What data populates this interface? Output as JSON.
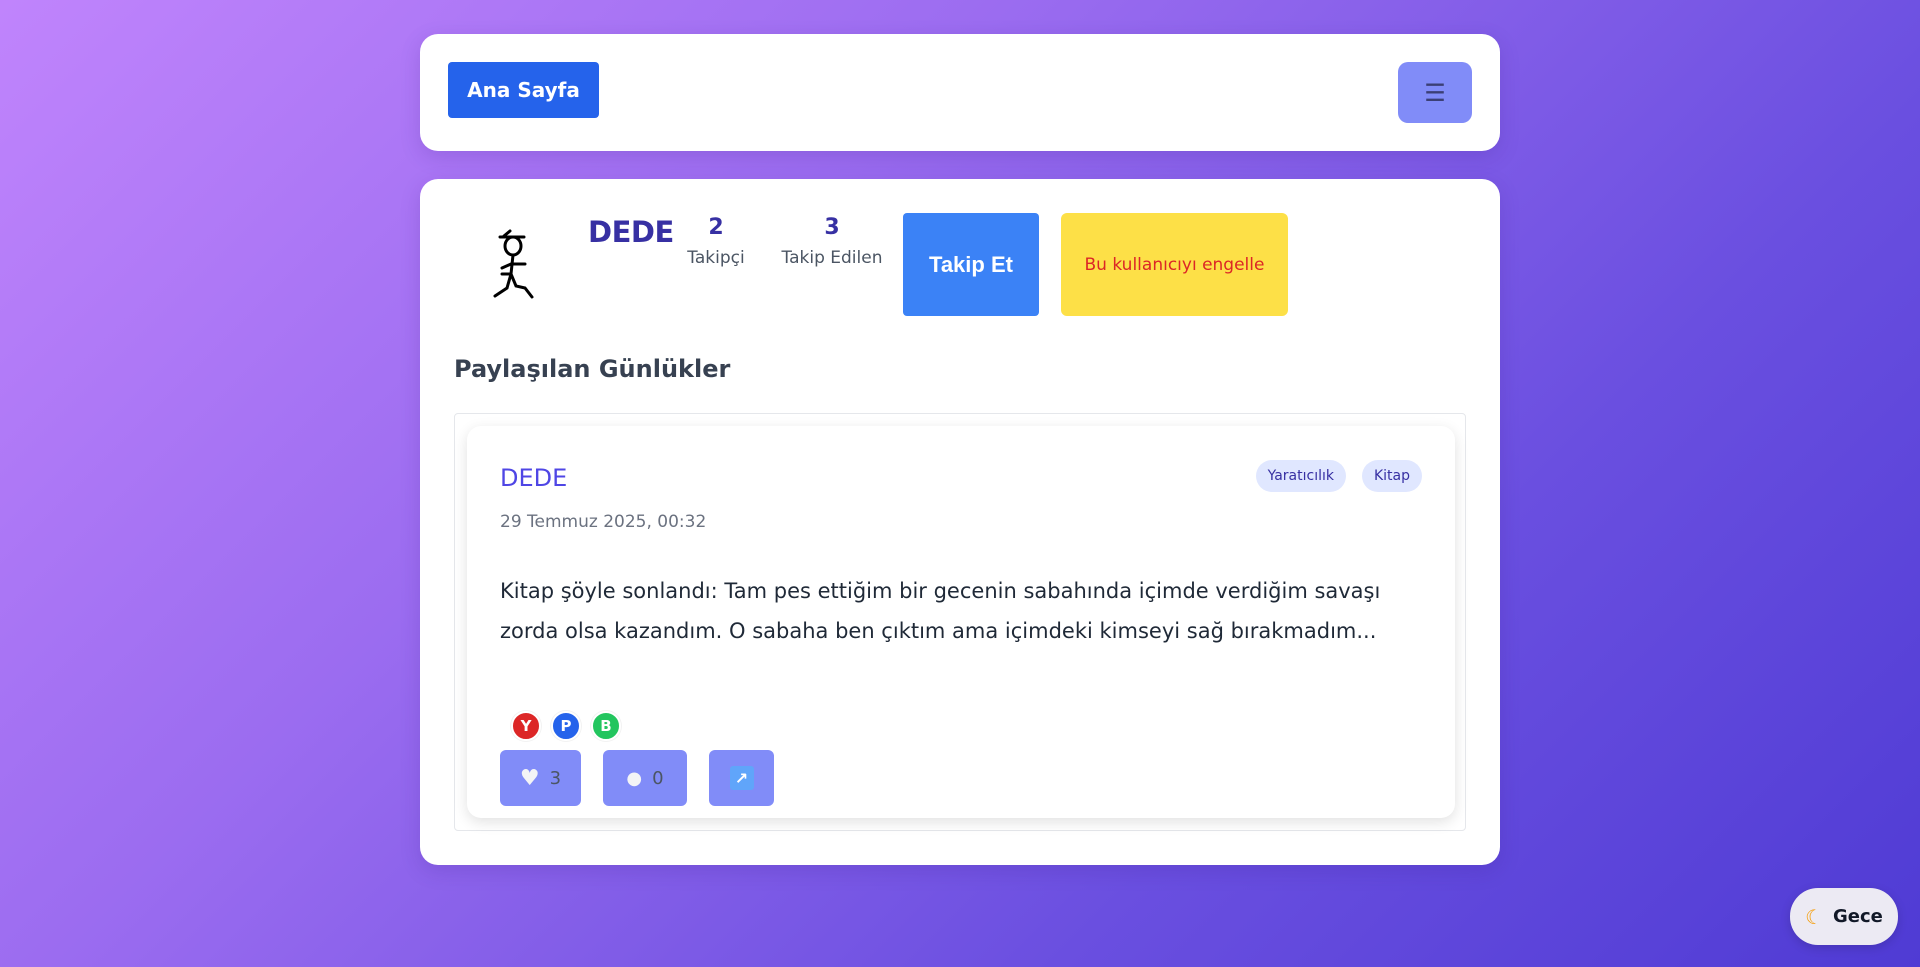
{
  "topbar": {
    "home_label": "Ana Sayfa",
    "menu_icon": "hamburger-icon",
    "menu_glyph": "☰"
  },
  "profile": {
    "username": "DEDE",
    "followers": {
      "count": "2",
      "label": "Takipçi"
    },
    "following": {
      "count": "3",
      "label": "Takip Edilen"
    },
    "follow_label": "Takip Et",
    "block_label": "Bu kullanıcıyı engelle"
  },
  "section_title": "Paylaşılan Günlükler",
  "post": {
    "author": "DEDE",
    "date": "29 Temmuz 2025, 00:32",
    "tags": [
      "Yaratıcılık",
      "Kitap"
    ],
    "body": "Kitap şöyle sonlandı: Tam pes ettiğim bir gecenin sabahında içimde verdiğim savaşı zorda olsa kazandım. O sabaha ben çıktım ama içimdeki kimseyi sağ bırakmadım...",
    "badges": [
      {
        "letter": "Y",
        "color": "#dc2626"
      },
      {
        "letter": "P",
        "color": "#2563eb"
      },
      {
        "letter": "B",
        "color": "#22c55e"
      }
    ],
    "likes": "3",
    "comments": "0"
  },
  "night_mode_label": "Gece",
  "colors": {
    "accent": "#2563eb",
    "indigo": "#3730a3",
    "menu": "#818cf8",
    "warning": "#fde047",
    "danger": "#dc2626"
  }
}
